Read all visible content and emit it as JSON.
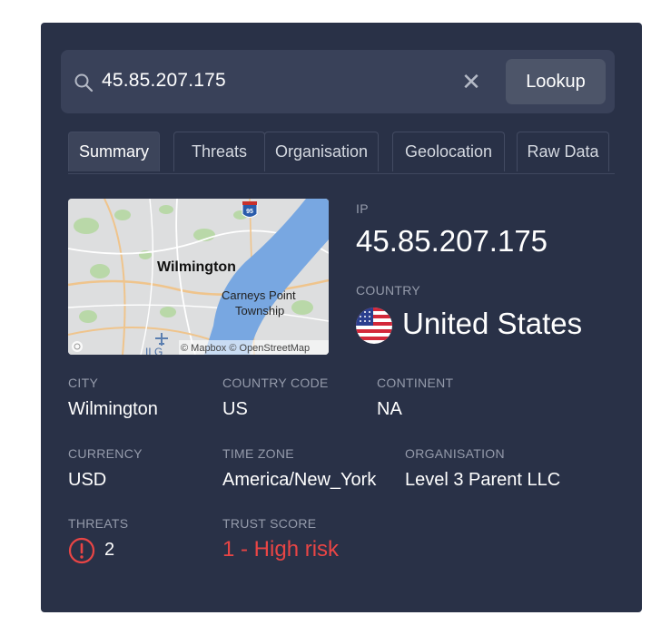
{
  "search": {
    "value": "45.85.207.175",
    "lookup_label": "Lookup"
  },
  "tabs": [
    {
      "label": "Summary"
    },
    {
      "label": "Threats"
    },
    {
      "label": "Organisation"
    },
    {
      "label": "Geolocation"
    },
    {
      "label": "Raw Data"
    }
  ],
  "map": {
    "city_label": "Wilmington",
    "place_label_1": "Carneys Point",
    "place_label_2": "Township",
    "shield": "95",
    "partial_label": "ILG",
    "attribution": "© Mapbox © OpenStreetMap"
  },
  "ip": {
    "label": "IP",
    "value": "45.85.207.175"
  },
  "country": {
    "label": "COUNTRY",
    "value": "United States"
  },
  "city": {
    "label": "CITY",
    "value": "Wilmington"
  },
  "country_code": {
    "label": "COUNTRY CODE",
    "value": "US"
  },
  "continent": {
    "label": "CONTINENT",
    "value": "NA"
  },
  "currency": {
    "label": "CURRENCY",
    "value": "USD"
  },
  "time_zone": {
    "label": "TIME ZONE",
    "value": "America/New_York"
  },
  "organisation": {
    "label": "ORGANISATION",
    "value": "Level 3 Parent LLC"
  },
  "threats": {
    "label": "THREATS",
    "value": "2"
  },
  "trust_score": {
    "label": "TRUST SCORE",
    "value": "1 - High risk"
  },
  "colors": {
    "card": "#293147",
    "search_bg": "#394159",
    "button_bg": "#4d5569",
    "risk": "#e94545",
    "label": "#959bab"
  },
  "icons": [
    "search-icon",
    "clear-icon",
    "us-flag-icon",
    "warning-icon",
    "plane-icon",
    "mapbox-logo-icon"
  ]
}
